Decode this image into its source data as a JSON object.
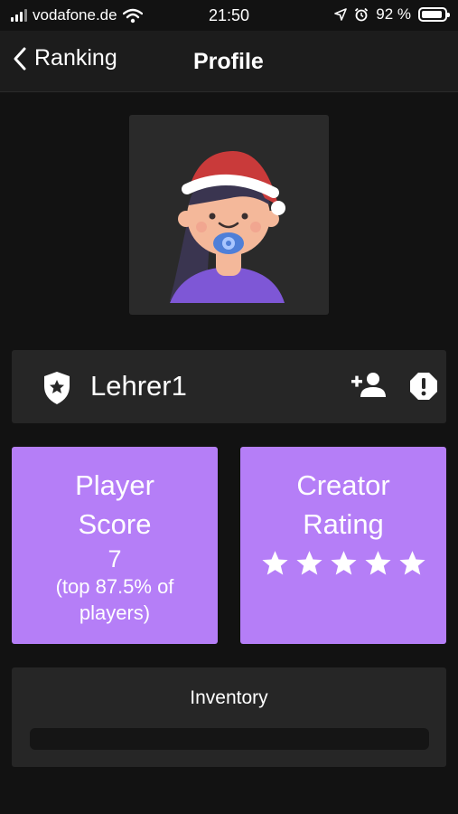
{
  "status_bar": {
    "carrier": "vodafone.de",
    "time": "21:50",
    "battery": "92 %",
    "battery_level": 0.92
  },
  "nav": {
    "back_label": "Ranking",
    "title": "Profile"
  },
  "user": {
    "name": "Lehrer1"
  },
  "player_score": {
    "title_line1": "Player",
    "title_line2": "Score",
    "value": "7",
    "note_line1": "(top 87.5% of",
    "note_line2": "players)"
  },
  "creator_rating": {
    "title_line1": "Creator",
    "title_line2": "Rating",
    "stars": 5,
    "max_stars": 5
  },
  "inventory": {
    "title": "Inventory"
  },
  "colors": {
    "background": "#121212",
    "card": "#262626",
    "accent": "#b57ef7"
  },
  "icons": [
    "signal-icon",
    "wifi-icon",
    "location-icon",
    "alarm-icon",
    "battery-icon",
    "back-chevron-icon",
    "shield-star-icon",
    "add-friend-icon",
    "report-icon",
    "star-icon"
  ]
}
